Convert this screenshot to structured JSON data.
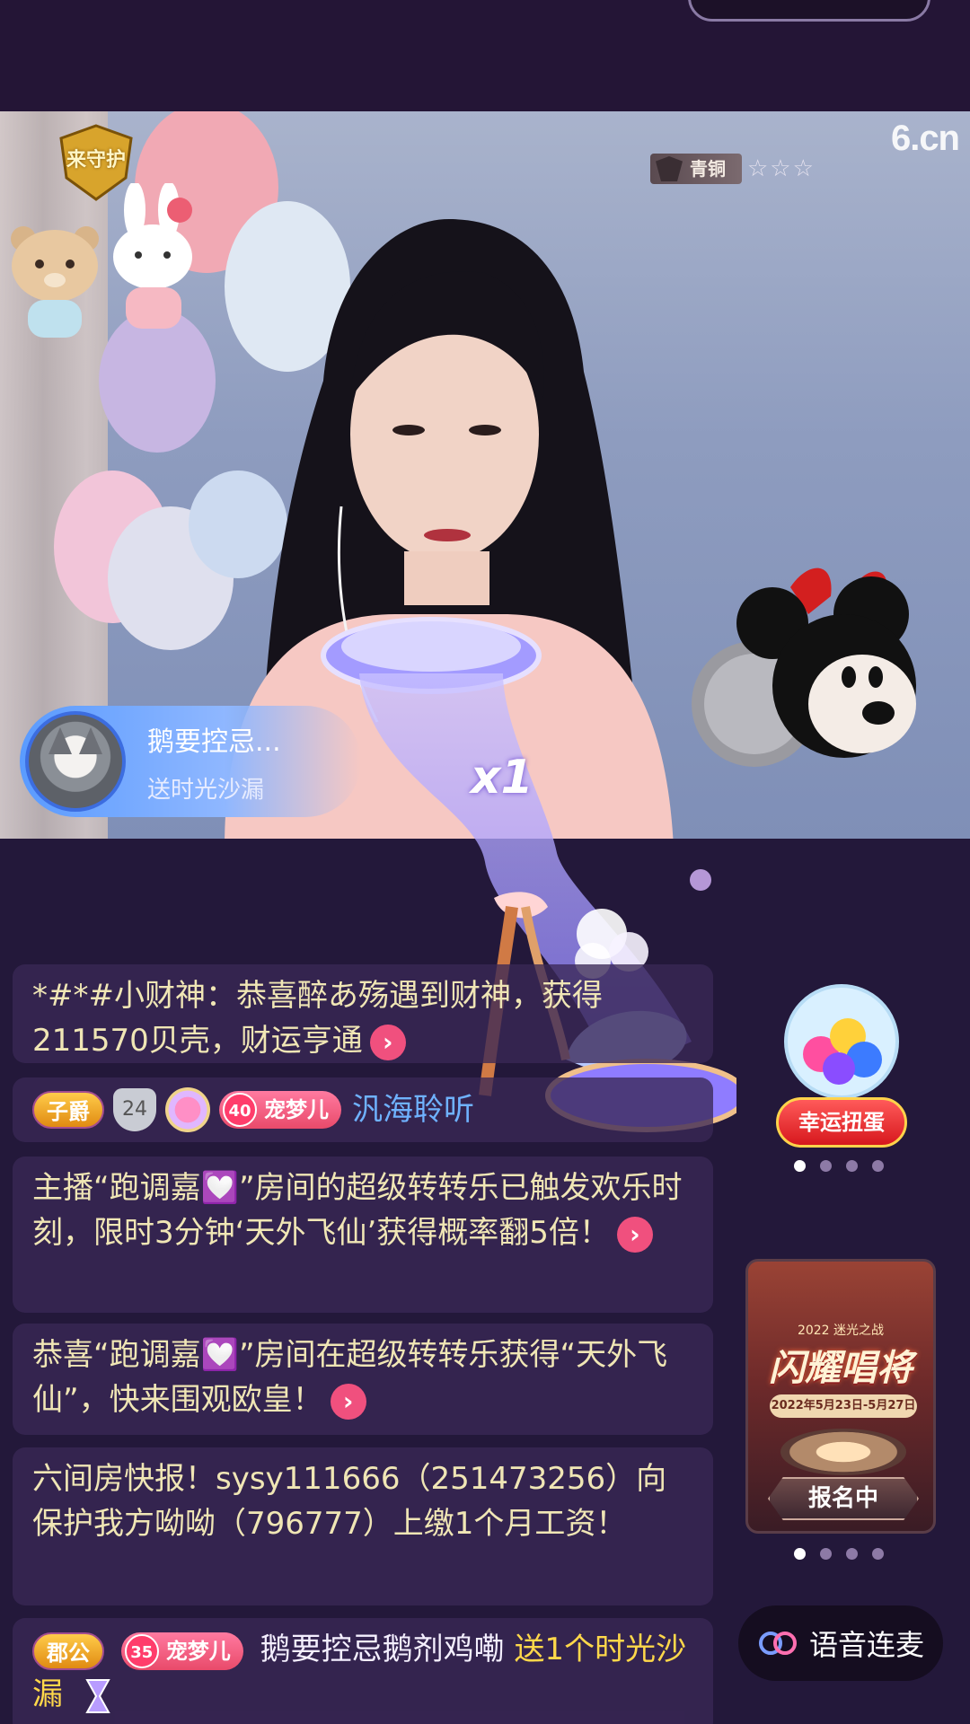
{
  "stream": {
    "guard_label": "来守护",
    "logo": "6.cn",
    "rank_label": "青铜",
    "rank_stars": "☆☆☆"
  },
  "gift_notice": {
    "user": "鹅要控忌...",
    "action": "送时光沙漏",
    "count": "x1"
  },
  "chat": {
    "msg1": "*#*#小财神：恭喜醉あ殇遇到财神，获得211570贝壳，财运亨通",
    "msg2": {
      "badge1": "子爵",
      "shield": "24",
      "badge2_level": "40",
      "badge2": "宠梦儿",
      "name": "汎海聆听"
    },
    "msg3": "主播“跑调嘉💟”房间的超级转转乐已触发欢乐时刻，限时3分钟‘天外飞仙’获得概率翻5倍！",
    "msg4": "恭喜“跑调嘉💟”房间在超级转转乐获得“天外飞仙”，快来围观欧皇！",
    "msg5": " 六间房快报！sysy111666（251473256）向 保护我方呦呦（796777）上缴1个月工资！",
    "msg6": {
      "badge1": "郡公",
      "badge2_level": "35",
      "badge2": "宠梦儿",
      "user": "鹅要控忌鹅剂鸡嘞",
      "gift": "送1个时光沙漏"
    },
    "go_icon": "chevron-right-icon"
  },
  "widgets": {
    "gacha_label": "幸运扭蛋",
    "event_sub": "2022 迷光之战",
    "event_title": "闪耀唱将",
    "event_date": "2022年5月23日-5月27日",
    "event_button": "报名中",
    "voice_button": "语音连麦"
  },
  "colors": {
    "background": "#23183a",
    "accent_pink": "#f0507e",
    "gold": "#ffd84a",
    "chat_text": "#f0e6b5"
  }
}
